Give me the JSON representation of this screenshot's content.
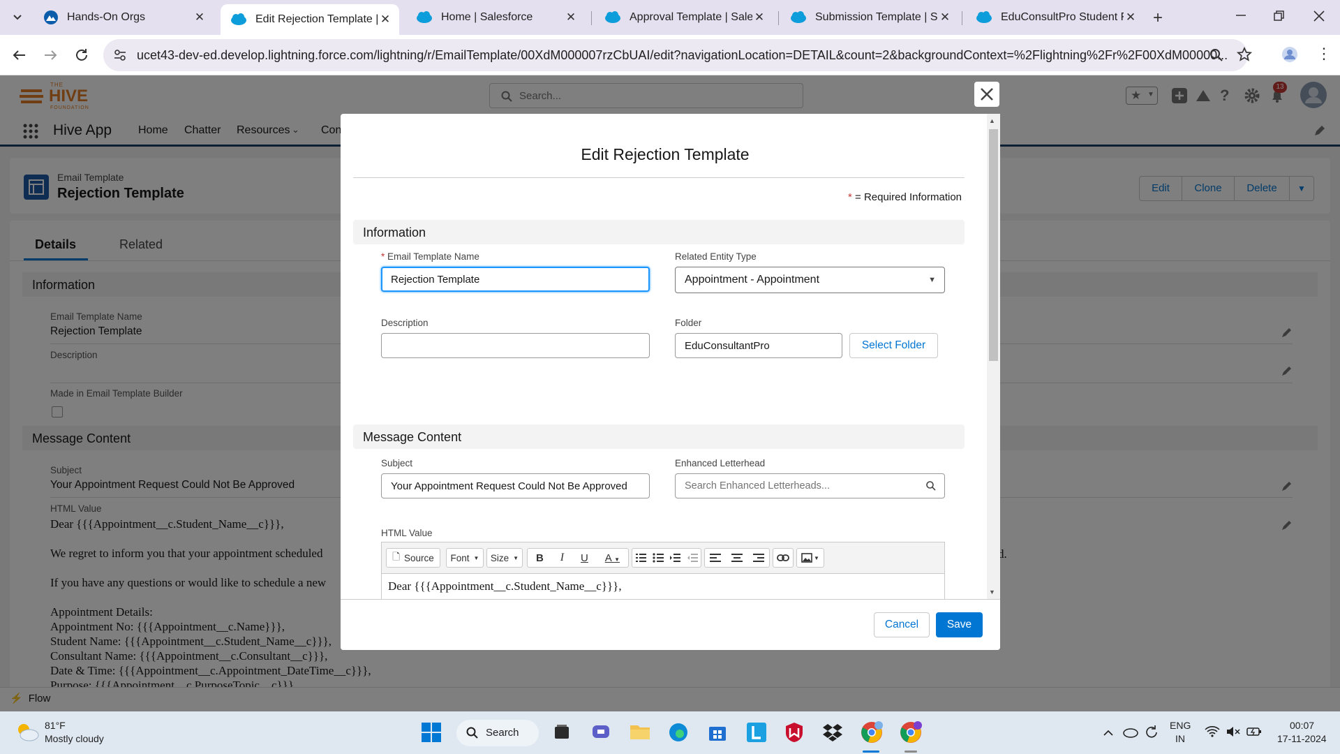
{
  "browser": {
    "tabs": [
      {
        "title": "Hands-On Orgs",
        "active": false
      },
      {
        "title": "Edit Rejection Template | Sa",
        "active": true
      },
      {
        "title": "Home | Salesforce",
        "active": false
      },
      {
        "title": "Approval Template | Salesfo",
        "active": false
      },
      {
        "title": "Submission Template | Sales",
        "active": false
      },
      {
        "title": "EduConsultPro Student Flo",
        "active": false
      }
    ],
    "url": "ucet43-dev-ed.develop.lightning.force.com/lightning/r/EmailTemplate/00XdM000007rzCbUAI/edit?navigationLocation=DETAIL&count=2&backgroundContext=%2Flightning%2Fr%2F00XdM00000..."
  },
  "header": {
    "logo_top": "THE",
    "logo_main": "HIVE",
    "logo_sub": "FOUNDATION",
    "search_placeholder": "Search...",
    "notif_count": "13"
  },
  "nav": {
    "app_name": "Hive App",
    "items": [
      "Home",
      "Chatter",
      "Resources",
      "Con"
    ]
  },
  "record": {
    "object_label": "Email Template",
    "title": "Rejection Template",
    "actions": [
      "Edit",
      "Clone",
      "Delete"
    ],
    "tabs": [
      "Details",
      "Related"
    ],
    "info_section": "Information",
    "fields": {
      "name_label": "Email Template Name",
      "name_value": "Rejection Template",
      "desc_label": "Description",
      "builder_label": "Made in Email Template Builder"
    },
    "message_section": "Message Content",
    "subject_label": "Subject",
    "subject_value": "Your Appointment Request Could Not Be Approved",
    "html_label": "HTML Value",
    "html_lines": [
      "Dear {{{Appointment__c.Student_Name__c}}},",
      "",
      "We regret to inform you that your appointment scheduled",
      "",
      "If you have any questions or would like to schedule a new",
      "",
      "Appointment Details:",
      "Appointment No: {{{Appointment__c.Name}}},",
      "Student Name: {{{Appointment__c.Student_Name__c}}},",
      "Consultant Name: {{{Appointment__c.Consultant__c}}},",
      "Date & Time: {{{Appointment__c.Appointment_DateTime__c}}},",
      "Purpose: {{{Appointment__c.PurposeTopic__c}}}"
    ],
    "right_trailing": "d."
  },
  "utility": {
    "flow_label": "Flow"
  },
  "modal": {
    "title": "Edit Rejection Template",
    "required_note": "= Required Information",
    "required_star": "*",
    "info_section": "Information",
    "name_label": "Email Template Name",
    "name_value": "Rejection Template",
    "entity_label": "Related Entity Type",
    "entity_value": "Appointment - Appointment",
    "desc_label": "Description",
    "desc_value": "",
    "folder_label": "Folder",
    "folder_value": "EduConsultantPro",
    "select_folder": "Select Folder",
    "message_section": "Message Content",
    "subject_label": "Subject",
    "subject_value": "Your Appointment Request Could Not Be Approved",
    "letterhead_label": "Enhanced Letterhead",
    "letterhead_placeholder": "Search Enhanced Letterheads...",
    "html_label": "HTML Value",
    "toolbar": {
      "source": "Source",
      "font": "Font",
      "size": "Size"
    },
    "editor_line": "Dear {{{Appointment__c.Student_Name__c}}},",
    "cancel": "Cancel",
    "save": "Save"
  },
  "taskbar": {
    "temp": "81°F",
    "weather": "Mostly cloudy",
    "search": "Search",
    "lang": "ENG",
    "region": "IN",
    "time": "00:07",
    "date": "17-11-2024"
  },
  "colors": {
    "brand": "#0176d3",
    "hive_orange": "#e07c24",
    "tabbar": "#e4e0ef"
  }
}
